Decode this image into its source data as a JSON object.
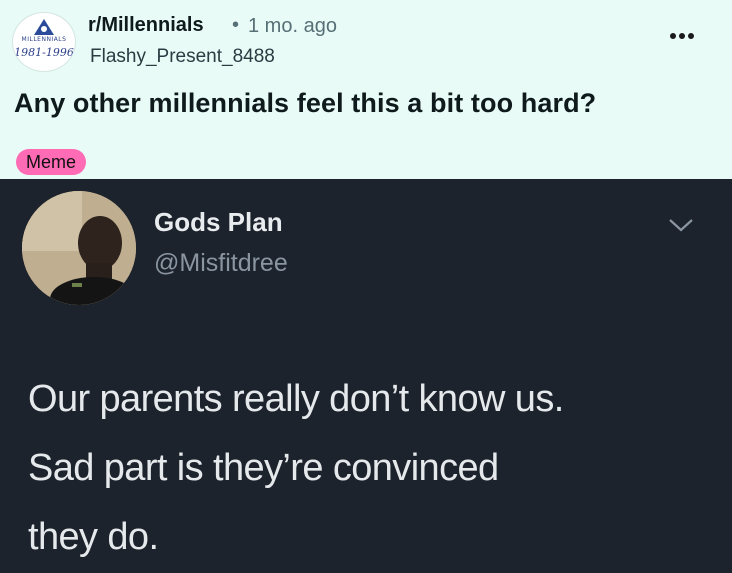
{
  "post": {
    "subreddit": "r/Millennials",
    "separator": "•",
    "age": "1 mo. ago",
    "author": "Flashy_Present_8488",
    "title": "Any other millennials feel this a bit too hard?",
    "flair": "Meme",
    "flair_color": "#ff6bb5",
    "subreddit_icon": {
      "ring_text": "MILLENNIALS",
      "years": "1981-1996"
    },
    "more_icon": "more-horizontal-icon"
  },
  "tweet": {
    "name": "Gods Plan",
    "handle": "@Misfitdree",
    "lines": [
      "Our parents really don’t know us.",
      "Sad part is they’re convinced",
      "they do."
    ],
    "menu_icon": "chevron-down-icon",
    "background": "#1d232c"
  }
}
